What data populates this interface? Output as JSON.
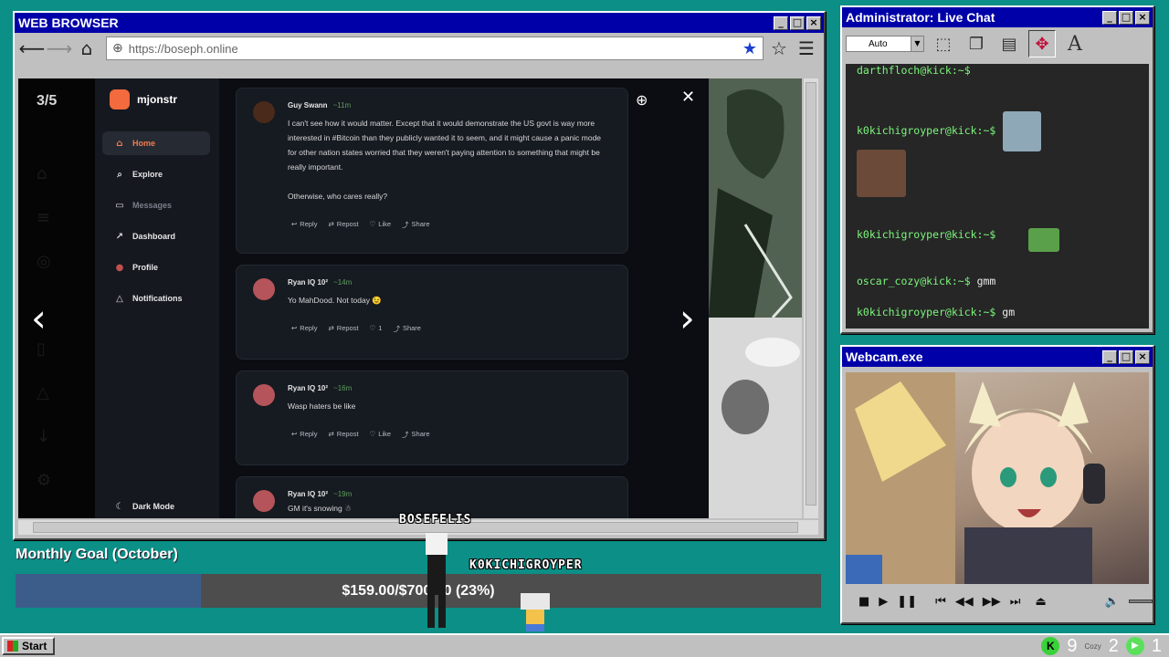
{
  "browser": {
    "title": "WEB BROWSER",
    "url": "https://boseph.online",
    "counter": "3/5",
    "app": {
      "name": "mjonstr",
      "nav": [
        {
          "label": "Home",
          "icon": "home-icon"
        },
        {
          "label": "Explore",
          "icon": "search-icon"
        },
        {
          "label": "Messages",
          "icon": "message-icon"
        },
        {
          "label": "Dashboard",
          "icon": "trend-icon"
        },
        {
          "label": "Profile",
          "icon": "avatar-icon"
        },
        {
          "label": "Notifications",
          "icon": "bell-icon"
        }
      ],
      "dark_mode": "Dark Mode",
      "posts": [
        {
          "author": "Guy Swann",
          "time": "~11m",
          "text": "I can't see how it would matter. Except  that it would demonstrate the US govt is way more interested in #Bitcoin than they publicly wanted it to seem, and it might cause a panic mode for other nation states worried that they weren't paying attention to something that might be really important.",
          "text2": "Otherwise, who cares really?",
          "actions": [
            "Reply",
            "Repost",
            "Like",
            "Share"
          ]
        },
        {
          "author": "Ryan IQ 10²",
          "time": "~14m",
          "text": "Yo MahDood. Not today 😉",
          "actions": [
            "Reply",
            "Repost",
            "1",
            "Share"
          ]
        },
        {
          "author": "Ryan IQ 10²",
          "time": "~16m",
          "text": "Wasp haters be like",
          "actions": [
            "Reply",
            "Repost",
            "Like",
            "Share"
          ]
        },
        {
          "author": "Ryan IQ 10²",
          "time": "~19m",
          "text": "GM it's snowing ☃"
        }
      ]
    }
  },
  "chat": {
    "title": "Administrator: Live Chat",
    "font_select": "Auto",
    "lines": [
      {
        "user": "darthfloch@kick:~$",
        "msg": ""
      },
      {
        "user": "k0kichigroyper@kick:~$",
        "msg": ""
      },
      {
        "user": "k0kichigroyper@kick:~$",
        "msg": ""
      },
      {
        "user": "oscar_cozy@kick:~$",
        "msg": "gmm"
      },
      {
        "user": "k0kichigroyper@kick:~$",
        "msg": "gm"
      }
    ]
  },
  "webcam": {
    "title": "Webcam.exe"
  },
  "overlay": {
    "goal_title": "Monthly Goal (October)",
    "goal_text": "$159.00/$700.00 (23%)",
    "goal_fraction": 0.23,
    "tag1": "BOSEFELIS",
    "tag2": "K0KICHIGROYPER"
  },
  "taskbar": {
    "start": "Start",
    "tray_count1": "9",
    "tray_cozy": "Cozy",
    "tray_count2": "2",
    "tray_count3": "1"
  },
  "colors": {
    "titlebar": "#0000a8",
    "desktop": "#0b8f86",
    "accent": "#f26a3d",
    "chat_user": "#7cf67c"
  }
}
